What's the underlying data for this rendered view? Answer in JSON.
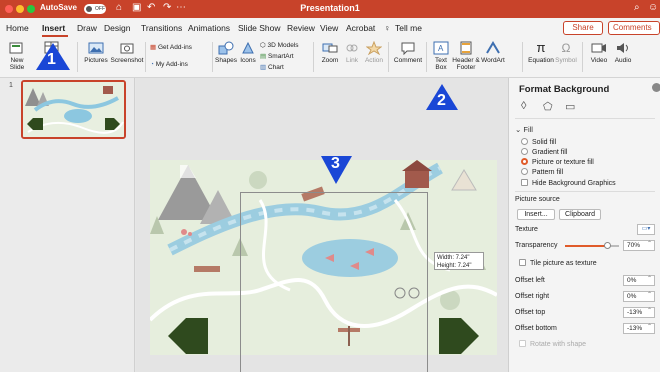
{
  "titlebar": {
    "autosave_label": "AutoSave",
    "autosave_state": "OFF",
    "doc_title": "Presentation1"
  },
  "tabs": [
    "Home",
    "Insert",
    "Draw",
    "Design",
    "Transitions",
    "Animations",
    "Slide Show",
    "Review",
    "View",
    "Acrobat",
    "Tell me"
  ],
  "active_tab": "Insert",
  "share_label": "Share",
  "comments_label": "Comments",
  "ribbon": {
    "new_slide": "New\nSlide",
    "pictures": "Pictures",
    "screenshot": "Screenshot",
    "get_addins": "Get Add-ins",
    "my_addins": "My Add-ins",
    "shapes": "Shapes",
    "icons": "Icons",
    "models_3d": "3D Models",
    "smartart": "SmartArt",
    "chart": "Chart",
    "zoom": "Zoom",
    "link": "Link",
    "action": "Action",
    "comment": "Comment",
    "text_box": "Text\nBox",
    "header_footer": "Header &\nFooter",
    "wordart": "WordArt",
    "equation": "Equation",
    "symbol": "Symbol",
    "video": "Video",
    "audio": "Audio"
  },
  "thumbnail": {
    "number": "1"
  },
  "callouts": {
    "c1": "1",
    "c2": "2",
    "c3": "3",
    "color": "#1a47d6"
  },
  "size_tooltip": {
    "width": "Width: 7.24\"",
    "height": "Height: 7.24\""
  },
  "format_pane": {
    "title": "Format Background",
    "section_fill": "Fill",
    "solid_fill": "Solid fill",
    "gradient_fill": "Gradient fill",
    "picture_fill": "Picture or texture fill",
    "pattern_fill": "Pattern fill",
    "hide_graphics": "Hide Background Graphics",
    "picture_source": "Picture source",
    "insert_btn": "Insert...",
    "clipboard_btn": "Clipboard",
    "texture": "Texture",
    "transparency": "Transparency",
    "transparency_value": "70%",
    "tile": "Tile picture as texture",
    "offset_left": "Offset left",
    "offset_left_value": "0%",
    "offset_right": "Offset right",
    "offset_right_value": "0%",
    "offset_top": "Offset top",
    "offset_top_value": "-13%",
    "offset_bottom": "Offset bottom",
    "offset_bottom_value": "-13%",
    "rotate": "Rotate with shape"
  },
  "colors": {
    "accent": "#c8432a",
    "radio_on": "#e05b2a",
    "arrow": "#2f4a1e"
  }
}
